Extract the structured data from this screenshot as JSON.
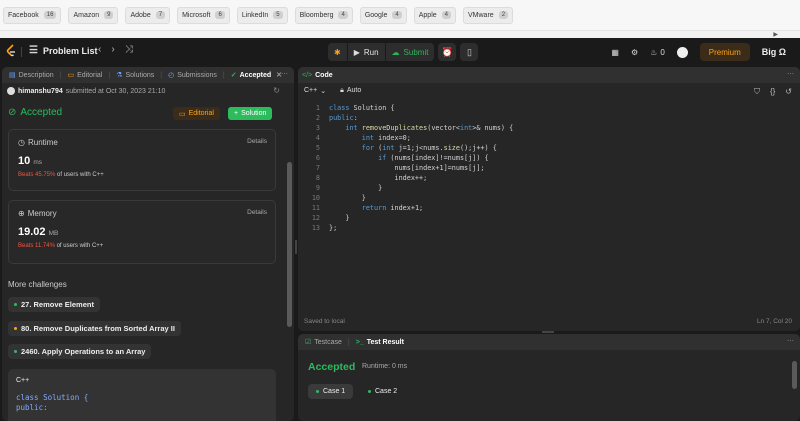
{
  "company_tags": [
    {
      "name": "Facebook",
      "count": "16"
    },
    {
      "name": "Amazon",
      "count": "9"
    },
    {
      "name": "Adobe",
      "count": "7"
    },
    {
      "name": "Microsoft",
      "count": "6"
    },
    {
      "name": "LinkedIn",
      "count": "5"
    },
    {
      "name": "Bloomberg",
      "count": "4"
    },
    {
      "name": "Google",
      "count": "4"
    },
    {
      "name": "Apple",
      "count": "4"
    },
    {
      "name": "VMware",
      "count": "2"
    }
  ],
  "nav": {
    "problem_list": "Problem List",
    "run": "Run",
    "submit": "Submit",
    "streak": "0",
    "premium": "Premium",
    "brand": "Big Ω"
  },
  "left_tabs": [
    "Description",
    "Editorial",
    "Solutions",
    "Submissions",
    "Accepted"
  ],
  "submission": {
    "user": "himanshu794",
    "info": "submitted at Oct 30, 2023 21:10",
    "status": "Accepted",
    "editorial_btn": "Editorial",
    "solution_btn": "Solution"
  },
  "runtime": {
    "label": "Runtime",
    "details": "Details",
    "value": "10",
    "unit": "ms",
    "beats": "Beats 45.75%",
    "suffix": "of users with C++"
  },
  "memory": {
    "label": "Memory",
    "details": "Details",
    "value": "19.02",
    "unit": "MB",
    "beats": "Beats 11.74%",
    "suffix": "of users with C++"
  },
  "more_challenges": "More challenges",
  "challenges": [
    {
      "title": "27. Remove Element",
      "color": "#2cbb5d"
    },
    {
      "title": "80. Remove Duplicates from Sorted Array II",
      "color": "#ffa116"
    },
    {
      "title": "2460. Apply Operations to an Array",
      "color": "#2cbb5d"
    }
  ],
  "code_preview": {
    "lang": "C++",
    "line1": "class Solution {",
    "line2": "public:"
  },
  "code_panel": {
    "title": "Code",
    "lang": "C++",
    "mode": "Auto",
    "saved": "Saved to local",
    "cursor": "Ln 7, Col 20",
    "lines": [
      "class Solution {",
      "public:",
      "    int removeDuplicates(vector<int>& nums) {",
      "        int index=0;",
      "        for (int j=1;j<nums.size();j++) {",
      "            if (nums[index]!=nums[j]) {",
      "                nums[index+1]=nums[j];",
      "                index++;",
      "            }",
      "        }",
      "        return index+1;",
      "    }",
      "};"
    ]
  },
  "test_panel": {
    "tab_testcase": "Testcase",
    "tab_result": "Test Result",
    "status": "Accepted",
    "runtime": "Runtime: 0 ms",
    "cases": [
      "Case 1",
      "Case 2"
    ]
  }
}
